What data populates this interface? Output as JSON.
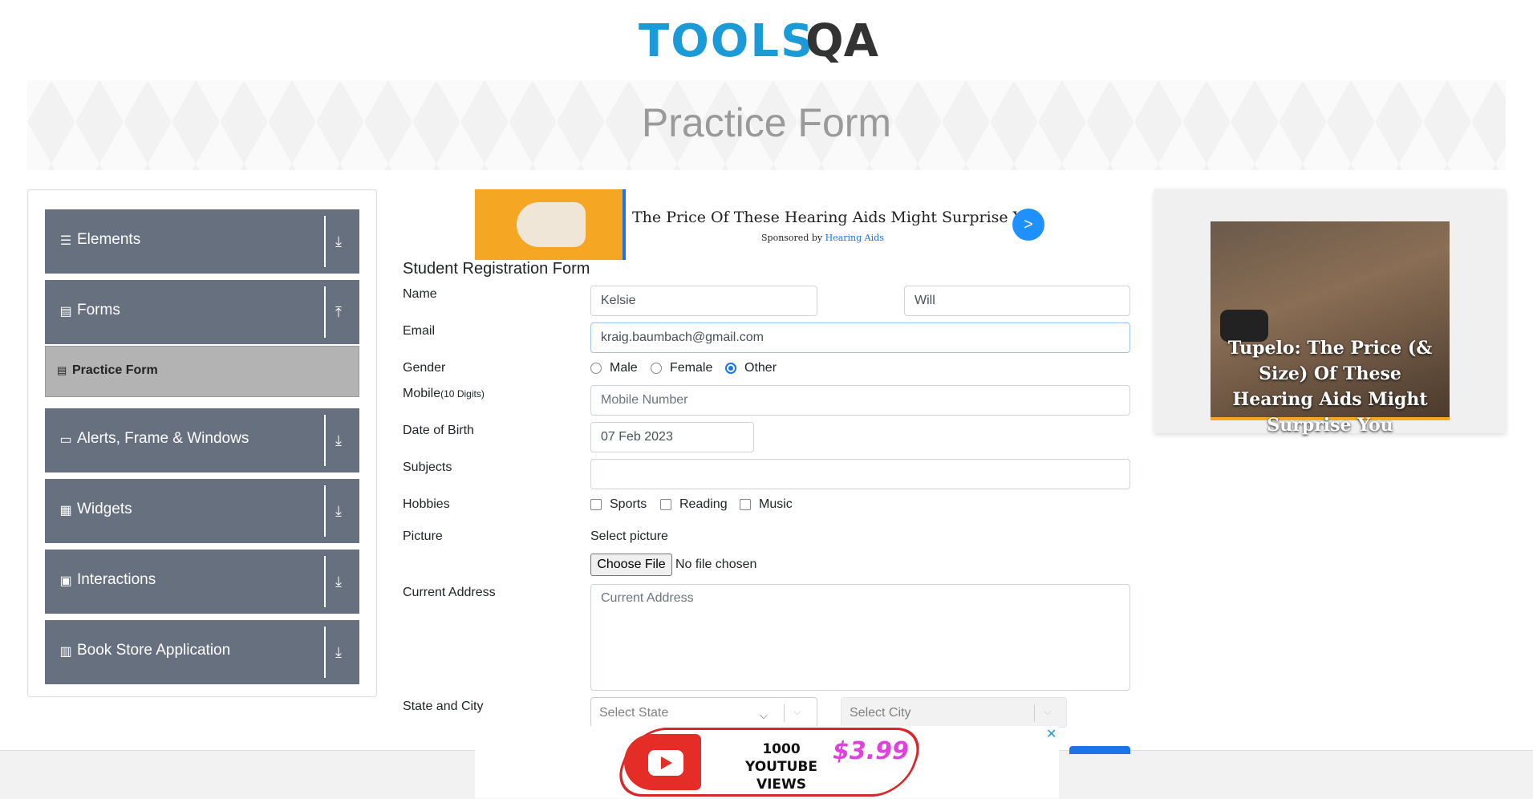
{
  "logo": {
    "part1": "TOOLS",
    "part2": "QA"
  },
  "banner": {
    "title": "Practice Form"
  },
  "sidebar": {
    "groups": [
      {
        "label": "Elements",
        "icon": "hamburger-icon",
        "arrow": "download-icon"
      },
      {
        "label": "Forms",
        "icon": "document-icon",
        "arrow": "upload-icon"
      },
      {
        "label": "Alerts, Frame & Windows",
        "icon": "window-icon",
        "arrow": "download-icon"
      },
      {
        "label": "Widgets",
        "icon": "grid-icon",
        "arrow": "download-icon"
      },
      {
        "label": "Interactions",
        "icon": "square-icon",
        "arrow": "download-icon"
      },
      {
        "label": "Book Store Application",
        "icon": "books-icon",
        "arrow": "download-icon"
      }
    ],
    "active_item": {
      "label": "Practice Form"
    }
  },
  "top_ad": {
    "headline": "The Price Of These Hearing Aids Might Surprise You",
    "sponsored_prefix": "Sponsored by",
    "sponsor": "Hearing Aids",
    "go": ">"
  },
  "form": {
    "title": "Student Registration Form",
    "labels": {
      "name": "Name",
      "email": "Email",
      "gender": "Gender",
      "mobile": "Mobile",
      "mobile_hint": "(10 Digits)",
      "dob": "Date of Birth",
      "subjects": "Subjects",
      "hobbies": "Hobbies",
      "picture": "Picture",
      "address": "Current Address",
      "state_city": "State and City"
    },
    "first_name": "Kelsie",
    "last_name": "Will",
    "email": "kraig.baumbach@gmail.com",
    "gender_options": [
      "Male",
      "Female",
      "Other"
    ],
    "gender_selected": "Other",
    "mobile_placeholder": "Mobile Number",
    "dob": "07 Feb 2023",
    "subjects": "",
    "hobbies": [
      "Sports",
      "Reading",
      "Music"
    ],
    "picture_label": "Select picture",
    "choose_file": "Choose File",
    "no_file": "No file chosen",
    "address_placeholder": "Current Address",
    "state_placeholder": "Select State",
    "city_placeholder": "Select City"
  },
  "right_ad": {
    "title": "Tupelo: The Price (& Size) Of These Hearing Aids Might Surprise You"
  },
  "bottom_ad": {
    "line1": "1000",
    "line2": "YOUTUBE VIEWS",
    "price": "$3.99",
    "close": "✕"
  },
  "colors": {
    "accent": "#1a73e8",
    "sidebar": "#67707e",
    "brand": "#1a9ad6"
  }
}
